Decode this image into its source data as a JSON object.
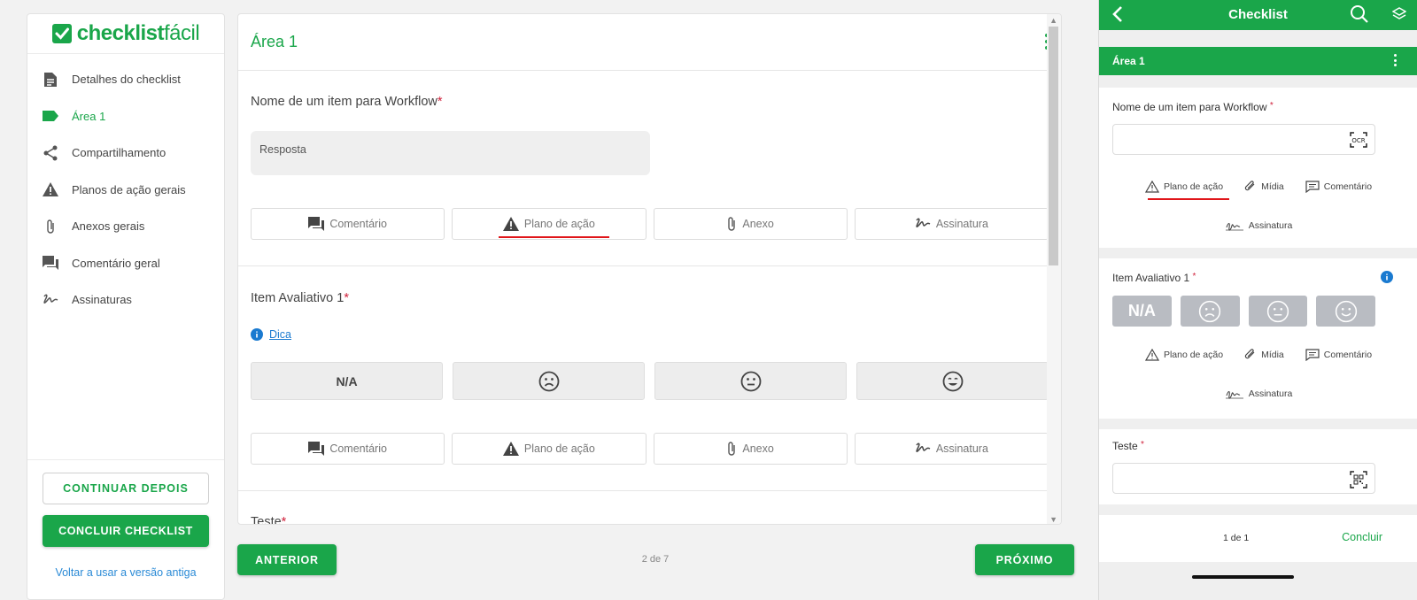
{
  "web": {
    "logo": {
      "bold": "checklist",
      "light": "fácil"
    },
    "sidebar": {
      "items": [
        {
          "label": "Detalhes do checklist",
          "icon": "document-icon"
        },
        {
          "label": "Área 1",
          "icon": "tag-icon"
        },
        {
          "label": "Compartilhamento",
          "icon": "share-icon"
        },
        {
          "label": "Planos de ação gerais",
          "icon": "warning-icon"
        },
        {
          "label": "Anexos gerais",
          "icon": "paperclip-icon"
        },
        {
          "label": "Comentário geral",
          "icon": "comment-icon"
        },
        {
          "label": "Assinaturas",
          "icon": "signature-icon"
        }
      ],
      "active_index": 1,
      "continue_later": "CONTINUAR DEPOIS",
      "finish": "CONCLUIR CHECKLIST",
      "old_version_link": "Voltar a usar a versão antiga"
    },
    "main": {
      "area_title": "Área 1",
      "questions": [
        {
          "label": "Nome de um item para Workflow",
          "required": "*",
          "answer_placeholder": "Resposta"
        },
        {
          "label": "Item Avaliativo 1",
          "required": "*",
          "tip": "Dica",
          "ratings": [
            "N/A",
            "☹",
            "😐",
            "😊"
          ]
        },
        {
          "label": "Teste",
          "required": "*"
        }
      ],
      "actions": {
        "comment": "Comentário",
        "action_plan": "Plano de ação",
        "attachment": "Anexo",
        "signature": "Assinatura"
      }
    },
    "footer": {
      "prev": "ANTERIOR",
      "next": "PRÓXIMO",
      "pager": "2 de 7"
    }
  },
  "mobile": {
    "title": "Checklist",
    "area_title": "Área 1",
    "questions": [
      {
        "label": "Nome de um item para Workflow",
        "required": "*"
      },
      {
        "label": "Item Avaliativo 1",
        "required": "*",
        "ratings": [
          "N/A"
        ]
      },
      {
        "label": "Teste",
        "required": "*"
      }
    ],
    "actions": {
      "action_plan": "Plano de ação",
      "media": "Mídia",
      "comment": "Comentário",
      "signature": "Assinatura"
    },
    "footer": {
      "pager": "1 de 1",
      "finish": "Concluir"
    }
  },
  "colors": {
    "brand_green": "#1aa64a",
    "required_red": "#d0213b",
    "highlight_red": "#e0161a",
    "link_blue": "#1a7ad0"
  }
}
